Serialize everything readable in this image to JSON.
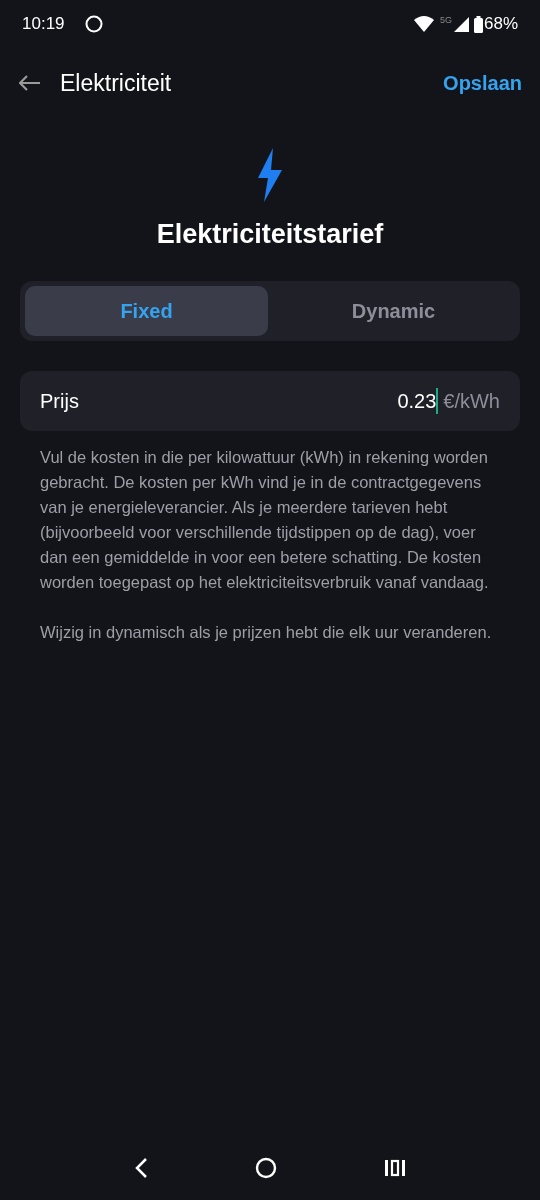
{
  "status_bar": {
    "time": "10:19",
    "network": "5G",
    "battery": "68%"
  },
  "header": {
    "title": "Elektriciteit",
    "action": "Opslaan"
  },
  "heading": "Elektriciteitstarief",
  "tabs": [
    {
      "label": "Fixed",
      "selected": true
    },
    {
      "label": "Dynamic",
      "selected": false
    }
  ],
  "price_field": {
    "label": "Prijs",
    "value": "0.23",
    "unit": "€/kWh"
  },
  "description": [
    "Vul de kosten in die per kilowattuur (kWh) in rekening worden gebracht. De kosten per kWh vind je in de contractgegevens van je energieleverancier. Als je meerdere tarieven hebt (bijvoorbeeld voor verschillende tijdstippen op de dag), voer dan een gemiddelde in voor een betere schatting. De kosten worden toegepast op het elektriciteitsverbruik vanaf vandaag.",
    "Wijzig in dynamisch als je prijzen hebt die elk uur veranderen."
  ]
}
